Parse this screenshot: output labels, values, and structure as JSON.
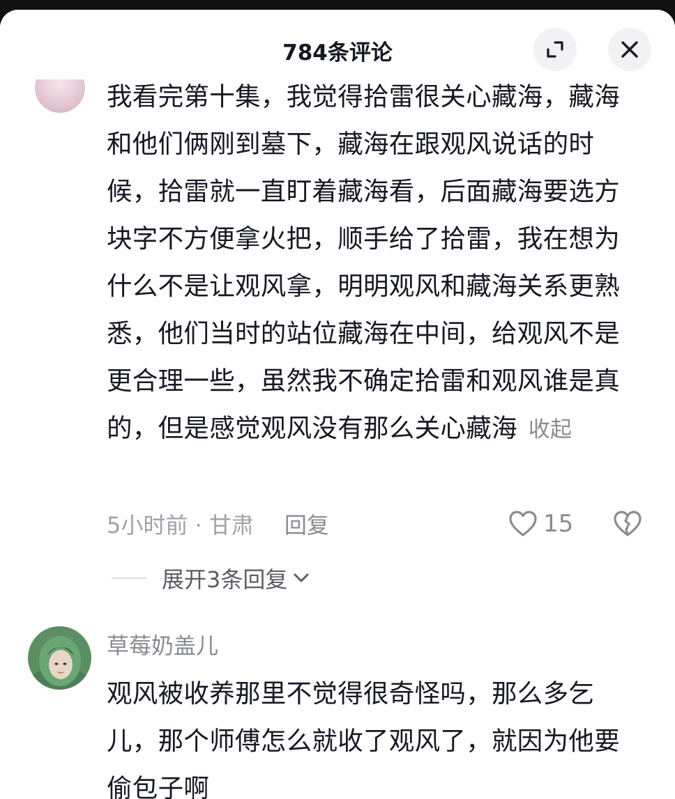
{
  "header": {
    "title": "784条评论",
    "expand_icon": "expand-icon",
    "close_icon": "close-icon"
  },
  "comments": [
    {
      "text": "我看完第十集，我觉得拾雷很关心藏海，藏海和他们俩刚到墓下，藏海在跟观风说话的时候，拾雷就一直盯着藏海看，后面藏海要选方块字不方便拿火把，顺手给了拾雷，我在想为什么不是让观风拿，明明观风和藏海关系更熟悉，他们当时的站位藏海在中间，给观风不是更合理一些，虽然我不确定拾雷和观风谁是真的，但是感觉观风没有那么关心藏海",
      "collapse_label": "收起",
      "time_location": "5小时前 · 甘肃",
      "reply_label": "回复",
      "like_count": "15",
      "expand_replies_label": "展开3条回复"
    },
    {
      "username": "草莓奶盖儿",
      "text": "观风被收养那里不觉得很奇怪吗，那么多乞儿，那个师傅怎么就收了观风了，就因为他要偷包子啊"
    }
  ],
  "colors": {
    "text_primary": "#161823",
    "text_secondary": "#8a8b91",
    "text_meta": "#a1a2a8",
    "button_bg": "#f2f2f4",
    "backdrop": "#111111"
  }
}
